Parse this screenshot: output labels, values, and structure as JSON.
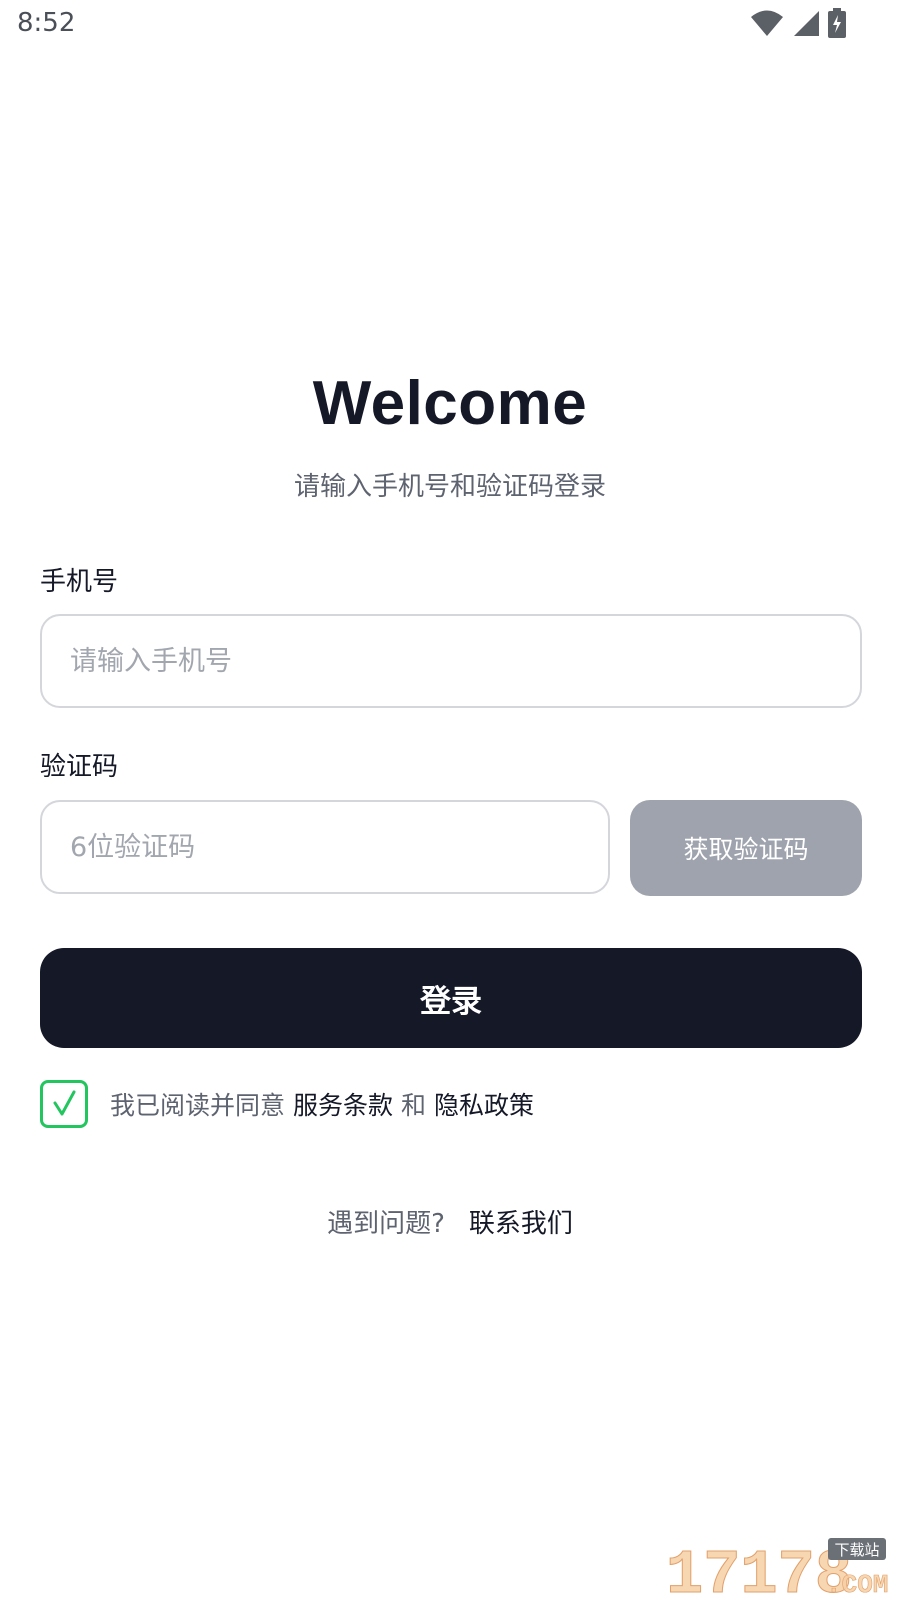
{
  "status_bar": {
    "time": "8:52",
    "icons": [
      "wifi-icon",
      "signal-icon",
      "battery-charging-icon"
    ]
  },
  "header": {
    "title": "Welcome",
    "subtitle": "请输入手机号和验证码登录"
  },
  "form": {
    "phone": {
      "label": "手机号",
      "placeholder": "请输入手机号",
      "value": ""
    },
    "code": {
      "label": "验证码",
      "placeholder": "6位验证码",
      "value": ""
    },
    "send_code_label": "获取验证码",
    "login_label": "登录"
  },
  "agreement": {
    "checked": true,
    "prefix": "我已阅读并同意",
    "terms_label": "服务条款",
    "conjunction": "和",
    "privacy_label": "隐私政策"
  },
  "help": {
    "question": "遇到问题?",
    "contact_label": "联系我们"
  },
  "watermark": {
    "number": "17178",
    "tag": "下载站",
    "suffix": ".COM"
  },
  "colors": {
    "primary": "#141827",
    "muted_text": "#5e6370",
    "placeholder": "#a2a6ae",
    "input_border": "#d4d6db",
    "disabled_button": "#9ea3ad",
    "check_green": "#22c55e"
  }
}
